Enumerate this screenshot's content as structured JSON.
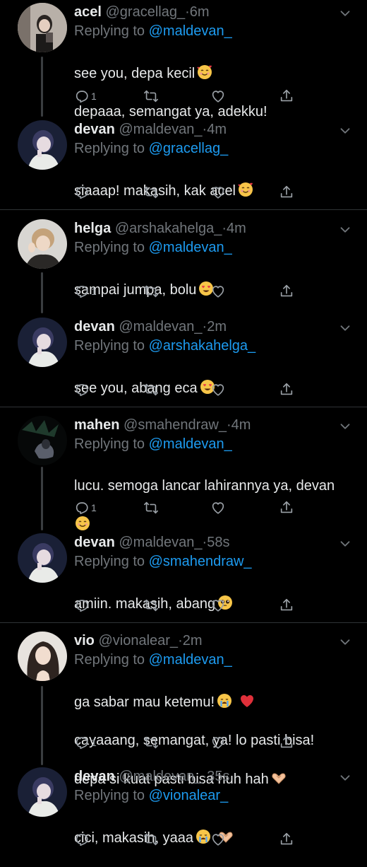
{
  "replying_to_label": "Replying to",
  "tweets": [
    {
      "name": "acel",
      "handle": "@gracellag_",
      "dot": "·",
      "time": "6m",
      "mention": "@maldevan_",
      "lines": [
        "see you, depa kecil",
        "depaaa, semangat ya, adekku!"
      ],
      "reply_count": "1",
      "emoji_line0": "smiling-hearts"
    },
    {
      "name": "devan",
      "handle": "@maldevan_",
      "dot": "·",
      "time": "4m",
      "mention": "@gracellag_",
      "lines": [
        "siaaap! makasih, kak acel"
      ],
      "reply_count": "",
      "emoji_line0": "smiling-hearts"
    },
    {
      "name": "helga",
      "handle": "@arshakahelga_",
      "dot": "·",
      "time": "4m",
      "mention": "@maldevan_",
      "lines": [
        "sampai jumpa, bolu"
      ],
      "reply_count": "1",
      "emoji_line0": "heart-eyes"
    },
    {
      "name": "devan",
      "handle": "@maldevan_",
      "dot": "·",
      "time": "2m",
      "mention": "@arshakahelga_",
      "lines": [
        "see you, abang eca"
      ],
      "reply_count": "",
      "emoji_line0": "heart-eyes"
    },
    {
      "name": "mahen",
      "handle": "@smahendraw_",
      "dot": "·",
      "time": "4m",
      "mention": "@maldevan_",
      "lines": [
        "lucu. semoga lancar lahirannya ya, devan",
        ""
      ],
      "reply_count": "1",
      "emoji_line1": "smile"
    },
    {
      "name": "devan",
      "handle": "@maldevan_",
      "dot": "·",
      "time": "58s",
      "mention": "@smahendraw_",
      "lines": [
        "amiin. makasih, abang"
      ],
      "reply_count": "",
      "emoji_line0": "pleading"
    },
    {
      "name": "vio",
      "handle": "@vionalear_",
      "dot": "·",
      "time": "2m",
      "mention": "@maldevan_",
      "lines": [
        "ga sabar mau ketemu!",
        "cayaaang, semangat, ya! lo pasti bisa!",
        "depa si kuat pasti bisa huh hah"
      ],
      "reply_count": "1",
      "emoji_line0": "crying-heart",
      "emoji_line2": "heart-hands"
    },
    {
      "name": "devan",
      "handle": "@maldevan_",
      "dot": "·",
      "time": "35s",
      "mention": "@vionalear_",
      "lines": [
        "cici, makasih, yaaa"
      ],
      "reply_count": "",
      "emoji_line0": "crying-hands"
    }
  ],
  "colors": {
    "background": "#000000",
    "text": "#e7e9ea",
    "muted": "#71767b",
    "link": "#1d9bf0",
    "separator": "#2f3336"
  }
}
